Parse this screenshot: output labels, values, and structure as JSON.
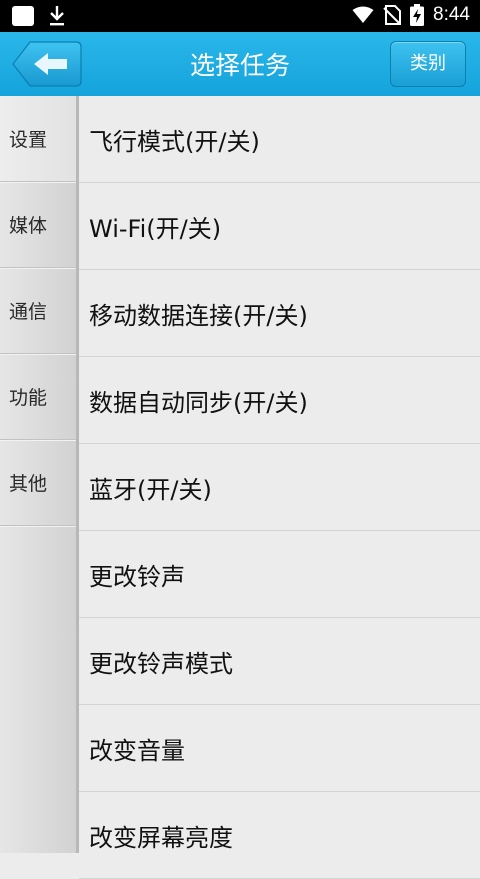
{
  "status_bar": {
    "time": "8:44",
    "icons": [
      "app-notification-icon",
      "download-icon",
      "wifi-icon",
      "no-sim-icon",
      "battery-charging-icon"
    ]
  },
  "header": {
    "title": "选择任务",
    "back_icon": "back-arrow-icon",
    "category_button": "类别"
  },
  "sidebar": {
    "items": [
      {
        "label": "设置"
      },
      {
        "label": "媒体"
      },
      {
        "label": "通信"
      },
      {
        "label": "功能"
      },
      {
        "label": "其他"
      }
    ]
  },
  "tasks": [
    {
      "label": "飞行模式(开/关)"
    },
    {
      "label": "Wi-Fi(开/关)"
    },
    {
      "label": "移动数据连接(开/关)"
    },
    {
      "label": "数据自动同步(开/关)"
    },
    {
      "label": "蓝牙(开/关)"
    },
    {
      "label": "更改铃声"
    },
    {
      "label": "更改铃声模式"
    },
    {
      "label": "改变音量"
    },
    {
      "label": "改变屏幕亮度"
    }
  ]
}
